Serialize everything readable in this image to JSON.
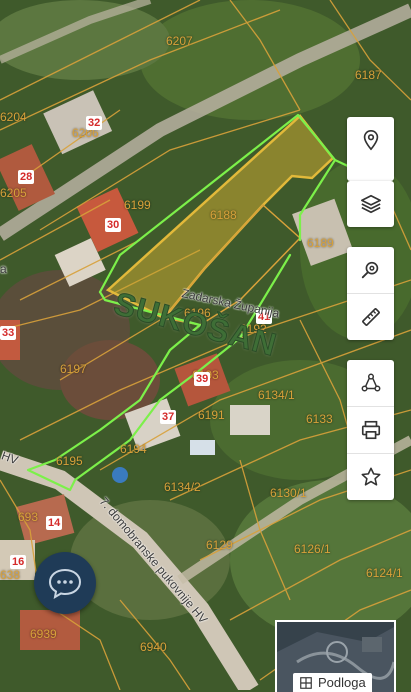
{
  "parcels": [
    {
      "label": "6207"
    },
    {
      "label": "6187"
    },
    {
      "label": "6204"
    },
    {
      "label": "6206"
    },
    {
      "label": "6205"
    },
    {
      "label": "6199"
    },
    {
      "label": "6188"
    },
    {
      "label": "6189"
    },
    {
      "label": "6196"
    },
    {
      "label": "6192"
    },
    {
      "label": "6197"
    },
    {
      "label": "6193"
    },
    {
      "label": "6134/1"
    },
    {
      "label": "6191"
    },
    {
      "label": "6133"
    },
    {
      "label": "6194"
    },
    {
      "label": "6195"
    },
    {
      "label": "6134/2"
    },
    {
      "label": "6130/1"
    },
    {
      "label": "6129"
    },
    {
      "label": "6126/1"
    },
    {
      "label": "6124/1"
    },
    {
      "label": "6939"
    },
    {
      "label": "6940"
    },
    {
      "label": "693"
    },
    {
      "label": "638"
    }
  ],
  "house_numbers": [
    "32",
    "28",
    "30",
    "41",
    "39",
    "37",
    "33",
    "14",
    "16"
  ],
  "streets": {
    "zadarska": "Zadarska Županija",
    "domobranske": "7. domobranske pukovnije HV",
    "hv_left": "HV",
    "a_left": "a"
  },
  "place_name": "SUKOŠAN",
  "toolbar_top": [
    {
      "icon": "location-pin-icon"
    },
    {
      "icon": "layers-icon"
    },
    {
      "icon": "search-location-icon"
    },
    {
      "icon": "ruler-icon"
    }
  ],
  "toolbar_bottom": [
    {
      "icon": "network-icon"
    },
    {
      "icon": "print-icon"
    },
    {
      "icon": "star-icon"
    }
  ],
  "basemap": {
    "label": "Podloga"
  },
  "colors": {
    "parcel_line": "#d8a13a",
    "selected_outline": "#e2b93a",
    "drawn_line": "#7cf04a",
    "house_number": "#d42a2a",
    "chat_bg": "#1f3b57"
  }
}
